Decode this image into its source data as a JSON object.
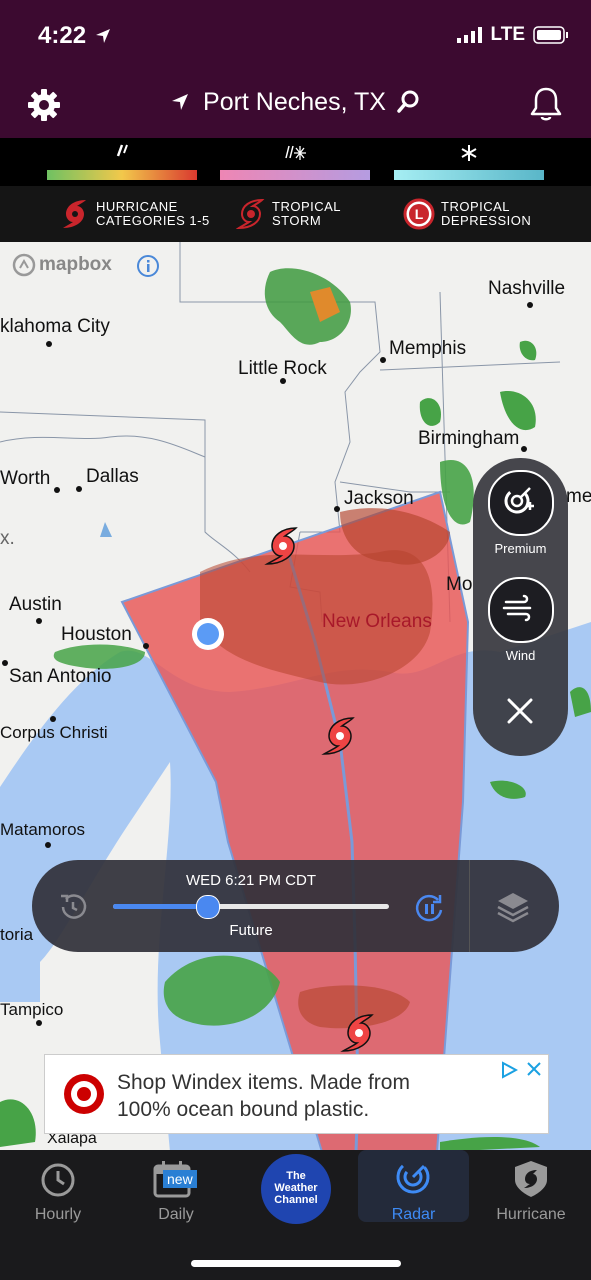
{
  "status": {
    "time": "4:22",
    "network": "LTE"
  },
  "header": {
    "location": "Port Neches, TX"
  },
  "legend": {
    "rain": {
      "icon": "rain-icon",
      "colors": [
        "#6fc162",
        "#f2c84b",
        "#d9392f"
      ]
    },
    "mix": {
      "icon": "mix-icon",
      "colors": [
        "#ee86b4",
        "#b59ce1"
      ]
    },
    "snow": {
      "icon": "snow-icon",
      "colors": [
        "#a6eef3",
        "#59b6c8"
      ]
    }
  },
  "storm_legend": [
    {
      "label_line1": "HURRICANE",
      "label_line2": "CATEGORIES 1-5",
      "icon": "hurricane-icon"
    },
    {
      "label_line1": "TROPICAL",
      "label_line2": "STORM",
      "icon": "tropical-storm-icon"
    },
    {
      "label_line1": "TROPICAL",
      "label_line2": "DEPRESSION",
      "icon": "tropical-depression-icon"
    }
  ],
  "map": {
    "attribution": "mapbox",
    "cities": {
      "nashville": "Nashville",
      "oklahoma_city": "klahoma City",
      "little_rock": "Little Rock",
      "memphis": "Memphis",
      "birmingham": "Birmingham",
      "fort_worth": "Worth",
      "dallas": "Dallas",
      "jackson": "Jackson",
      "montgomery_partial": "me",
      "mobile_partial": "Mo",
      "austin": "Austin",
      "houston": "Houston",
      "new_orleans": "New Orleans",
      "san_antonio": "San Antonio",
      "corpus_christi": "Corpus Christi",
      "matamoros": "Matamoros",
      "victoria_partial": "toria",
      "tampico": "Tampico",
      "xalapa": "Xalapa",
      "partial_x": "x."
    },
    "colors": {
      "water": "#a9c9f3",
      "land": "#f1f1ef",
      "cone": "#e85a5a",
      "location_dot": "#5b9bf5"
    }
  },
  "side_panel": {
    "premium_label": "Premium",
    "wind_label": "Wind"
  },
  "timeline": {
    "time_label": "WED 6:21 PM CDT",
    "mode_label": "Future",
    "progress": 0.34
  },
  "ad": {
    "line1": "Shop Windex items. Made from",
    "line2": "100% ocean bound plastic."
  },
  "tabs": [
    {
      "label": "Hourly",
      "icon": "clock-icon"
    },
    {
      "label": "Daily",
      "icon": "calendar-icon",
      "badge": "new"
    },
    {
      "logo_line1": "The",
      "logo_line2": "Weather",
      "logo_line3": "Channel"
    },
    {
      "label": "Radar",
      "icon": "radar-icon",
      "active": true
    },
    {
      "label": "Hurricane",
      "icon": "hurricane-tab-icon"
    }
  ]
}
